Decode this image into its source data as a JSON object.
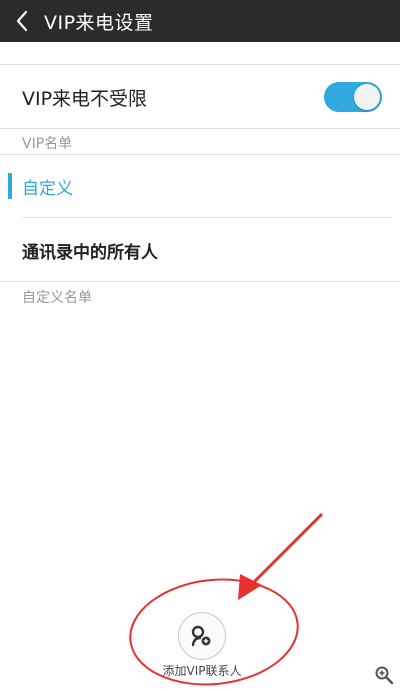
{
  "header": {
    "title": "VIP来电设置",
    "back_icon": "chevron-left-icon"
  },
  "vip_unlimited": {
    "label": "VIP来电不受限",
    "enabled": true,
    "toggle_color": "#2fa9de"
  },
  "vip_list": {
    "section_label": "VIP名单",
    "options": [
      {
        "label": "自定义",
        "selected": true
      },
      {
        "label": "通讯录中的所有人",
        "selected": false
      }
    ]
  },
  "custom_list": {
    "section_label": "自定义名单"
  },
  "add_contact": {
    "label": "添加VIP联系人",
    "icon": "add-contact-icon"
  },
  "colors": {
    "accent": "#2fa9de",
    "header_bg": "#2b2b2b",
    "annotation_red": "#e8312f"
  },
  "corner": {
    "icon": "zoom-in-icon"
  }
}
